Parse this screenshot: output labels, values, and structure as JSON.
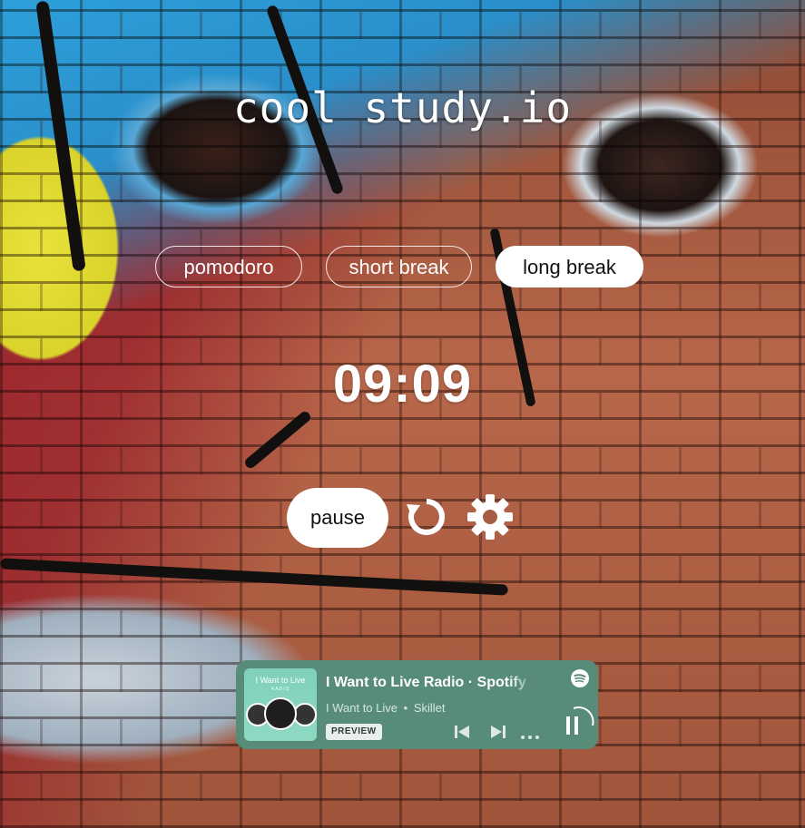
{
  "app": {
    "title": "cool study.io"
  },
  "modes": [
    {
      "label": "pomodoro",
      "active": false
    },
    {
      "label": "short break",
      "active": false
    },
    {
      "label": "long break",
      "active": true
    }
  ],
  "timer": {
    "display": "09:09"
  },
  "controls": {
    "pause_label": "pause",
    "reset_icon": "restart-icon",
    "settings_icon": "gear-icon"
  },
  "player": {
    "cover": {
      "title": "I Want to Live",
      "subtitle": "RADIO"
    },
    "track_title": "I Want to Live Radio · Spotify",
    "song": "I Want to Live",
    "separator": "•",
    "artist": "Skillet",
    "badge": "PREVIEW",
    "background_color": "#578c79",
    "icons": [
      "spotify-logo-icon",
      "skip-previous-icon",
      "skip-next-icon",
      "more-icon",
      "pause-icon"
    ]
  },
  "colors": {
    "text": "#ffffff",
    "active_tab_bg": "#ffffff",
    "active_tab_text": "#111111"
  }
}
